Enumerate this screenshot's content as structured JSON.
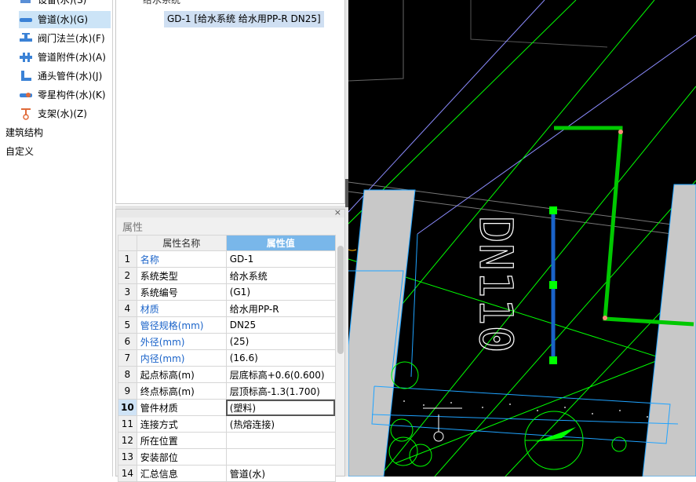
{
  "tree": {
    "items": [
      {
        "label": "设备(水)(S)",
        "icon": "equipment-icon",
        "selected": false
      },
      {
        "label": "管道(水)(G)",
        "icon": "pipe-icon",
        "selected": true
      },
      {
        "label": "阀门法兰(水)(F)",
        "icon": "valve-icon",
        "selected": false
      },
      {
        "label": "管道附件(水)(A)",
        "icon": "pipe-accessory-icon",
        "selected": false
      },
      {
        "label": "通头管件(水)(J)",
        "icon": "fitting-icon",
        "selected": false
      },
      {
        "label": "零星构件(水)(K)",
        "icon": "misc-component-icon",
        "selected": false
      },
      {
        "label": "支架(水)(Z)",
        "icon": "support-icon",
        "selected": false
      }
    ],
    "roots": [
      "建筑结构",
      "自定义"
    ]
  },
  "component_list": {
    "group": "给水系统",
    "entry": "GD-1 [给水系统 给水用PP-R DN25]"
  },
  "properties": {
    "title": "属性",
    "close": "×",
    "col_name": "属性名称",
    "col_value": "属性值",
    "rows": [
      {
        "num": "1",
        "name": "名称",
        "value": "GD-1",
        "blue": true
      },
      {
        "num": "2",
        "name": "系统类型",
        "value": "给水系统",
        "blue": false
      },
      {
        "num": "3",
        "name": "系统编号",
        "value": "(G1)",
        "blue": false
      },
      {
        "num": "4",
        "name": "材质",
        "value": "给水用PP-R",
        "blue": true
      },
      {
        "num": "5",
        "name": "管径规格(mm)",
        "value": "DN25",
        "blue": true
      },
      {
        "num": "6",
        "name": "外径(mm)",
        "value": "(25)",
        "blue": true
      },
      {
        "num": "7",
        "name": "内径(mm)",
        "value": "(16.6)",
        "blue": true
      },
      {
        "num": "8",
        "name": "起点标高(m)",
        "value": "层底标高+0.6(0.600)",
        "blue": false
      },
      {
        "num": "9",
        "name": "终点标高(m)",
        "value": "层顶标高-1.3(1.700)",
        "blue": false
      },
      {
        "num": "10",
        "name": "管件材质",
        "value": "(塑料)",
        "blue": false
      },
      {
        "num": "11",
        "name": "连接方式",
        "value": "(热熔连接)",
        "blue": false
      },
      {
        "num": "12",
        "name": "所在位置",
        "value": "",
        "blue": false
      },
      {
        "num": "13",
        "name": "安装部位",
        "value": "",
        "blue": false
      },
      {
        "num": "14",
        "name": "汇总信息",
        "value": "管道(水)",
        "blue": false
      }
    ]
  },
  "cad": {
    "text": "DN110",
    "colors": {
      "background": "#000000",
      "green": "#00ff00",
      "pipe_selected": "#1a63c9",
      "cyan": "#1fa3ff",
      "wall": "#c8c8c8",
      "violet": "#8c8cff"
    }
  }
}
